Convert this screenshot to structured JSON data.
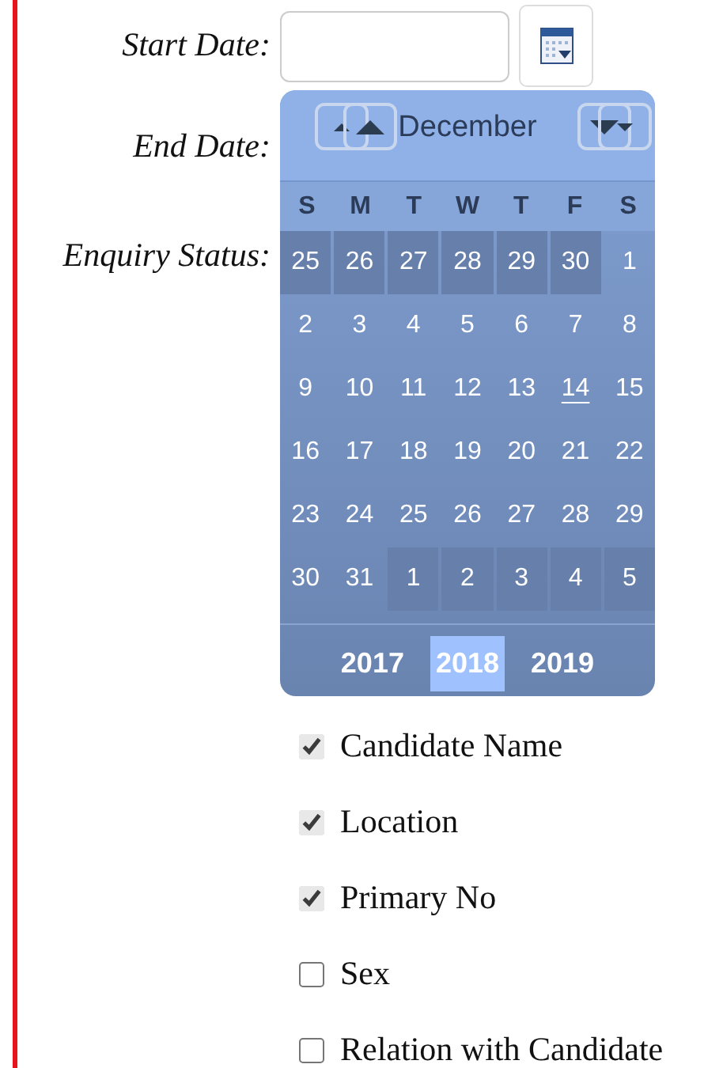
{
  "fields": [
    {
      "label": "Start Date:",
      "kind": "date"
    },
    {
      "label": "End Date:",
      "kind": "plain"
    },
    {
      "label": "Enquiry Status:",
      "kind": "plain"
    }
  ],
  "calendar": {
    "month": "December",
    "weekdays": [
      "S",
      "M",
      "T",
      "W",
      "T",
      "F",
      "S"
    ],
    "days": [
      {
        "text": "25",
        "other_month": true,
        "today": false
      },
      {
        "text": "26",
        "other_month": true,
        "today": false
      },
      {
        "text": "27",
        "other_month": true,
        "today": false
      },
      {
        "text": "28",
        "other_month": true,
        "today": false
      },
      {
        "text": "29",
        "other_month": true,
        "today": false
      },
      {
        "text": "30",
        "other_month": true,
        "today": false
      },
      {
        "text": "1",
        "other_month": false,
        "today": false
      },
      {
        "text": "2",
        "other_month": false,
        "today": false
      },
      {
        "text": "3",
        "other_month": false,
        "today": false
      },
      {
        "text": "4",
        "other_month": false,
        "today": false
      },
      {
        "text": "5",
        "other_month": false,
        "today": false
      },
      {
        "text": "6",
        "other_month": false,
        "today": false
      },
      {
        "text": "7",
        "other_month": false,
        "today": false
      },
      {
        "text": "8",
        "other_month": false,
        "today": false
      },
      {
        "text": "9",
        "other_month": false,
        "today": false
      },
      {
        "text": "10",
        "other_month": false,
        "today": false
      },
      {
        "text": "11",
        "other_month": false,
        "today": false
      },
      {
        "text": "12",
        "other_month": false,
        "today": false
      },
      {
        "text": "13",
        "other_month": false,
        "today": false
      },
      {
        "text": "14",
        "other_month": false,
        "today": true
      },
      {
        "text": "15",
        "other_month": false,
        "today": false
      },
      {
        "text": "16",
        "other_month": false,
        "today": false
      },
      {
        "text": "17",
        "other_month": false,
        "today": false
      },
      {
        "text": "18",
        "other_month": false,
        "today": false
      },
      {
        "text": "19",
        "other_month": false,
        "today": false
      },
      {
        "text": "20",
        "other_month": false,
        "today": false
      },
      {
        "text": "21",
        "other_month": false,
        "today": false
      },
      {
        "text": "22",
        "other_month": false,
        "today": false
      },
      {
        "text": "23",
        "other_month": false,
        "today": false
      },
      {
        "text": "24",
        "other_month": false,
        "today": false
      },
      {
        "text": "25",
        "other_month": false,
        "today": false
      },
      {
        "text": "26",
        "other_month": false,
        "today": false
      },
      {
        "text": "27",
        "other_month": false,
        "today": false
      },
      {
        "text": "28",
        "other_month": false,
        "today": false
      },
      {
        "text": "29",
        "other_month": false,
        "today": false
      },
      {
        "text": "30",
        "other_month": false,
        "today": false
      },
      {
        "text": "31",
        "other_month": false,
        "today": false
      },
      {
        "text": "1",
        "other_month": true,
        "today": false
      },
      {
        "text": "2",
        "other_month": true,
        "today": false
      },
      {
        "text": "3",
        "other_month": true,
        "today": false
      },
      {
        "text": "4",
        "other_month": true,
        "today": false
      },
      {
        "text": "5",
        "other_month": true,
        "today": false
      }
    ],
    "years": [
      {
        "text": "2017",
        "selected": false
      },
      {
        "text": "2018",
        "selected": true
      },
      {
        "text": "2019",
        "selected": false
      }
    ]
  },
  "columns": [
    {
      "label": "Candidate Name",
      "checked": true
    },
    {
      "label": "Location",
      "checked": true
    },
    {
      "label": "Primary No",
      "checked": true
    },
    {
      "label": "Sex",
      "checked": false
    },
    {
      "label": "Relation with Candidate",
      "checked": false
    }
  ]
}
